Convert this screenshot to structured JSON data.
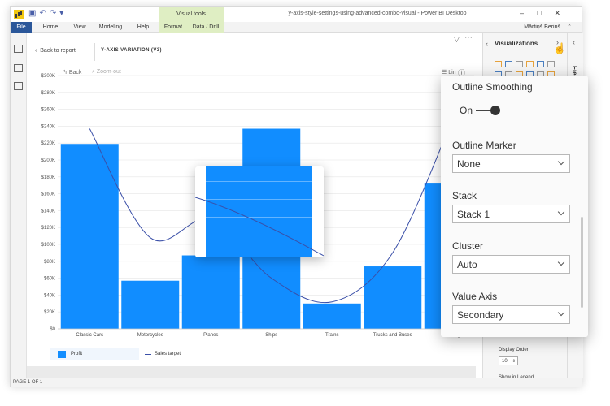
{
  "titlebar": {
    "visual_tools": "Visual tools",
    "window_title": "y-axis-style-settings-using-advanced-combo-visual - Power BI Desktop"
  },
  "ribbon": {
    "tabs": [
      "File",
      "Home",
      "View",
      "Modeling",
      "Help",
      "Format",
      "Data / Drill"
    ],
    "user": "Mārtiņš Beriņš"
  },
  "report": {
    "back_to_report": "Back to report",
    "visual_title": "Y-AXIS VARIATION (V3)",
    "back": "Back",
    "zoom_out": "Zoom-out",
    "lin": "Lin"
  },
  "chart_data": {
    "type": "bar",
    "categories": [
      "Classic Cars",
      "Motorcycles",
      "Planes",
      "Ships",
      "Trains",
      "Trucks and Buses",
      "Vintage Cars"
    ],
    "category_labels": [
      "Classic Cars",
      "Motorcycles",
      "Planes",
      "Ships",
      "Trains",
      "Trucks and Buses",
      "Vintag"
    ],
    "series": [
      {
        "name": "Profit",
        "type": "bar",
        "color": "#118dff",
        "values": [
          219000,
          57000,
          87000,
          237000,
          30000,
          74000,
          173000
        ]
      },
      {
        "name": "Sales target",
        "type": "line",
        "color": "#3a4fa8",
        "values": [
          237000,
          108000,
          130000,
          60000,
          32000,
          90000,
          250000
        ]
      }
    ],
    "yticks": [
      "$0",
      "$20K",
      "$40K",
      "$60K",
      "$80K",
      "$100K",
      "$120K",
      "$140K",
      "$160K",
      "$180K",
      "$200K",
      "$220K",
      "$240K",
      "$260K",
      "$280K",
      "$300K"
    ],
    "ylim": [
      0,
      300000
    ],
    "grid": true,
    "legend": "bottom-left"
  },
  "legend": {
    "profit": "Profit",
    "sales_target": "Sales target"
  },
  "status": {
    "page": "PAGE 1 OF 1"
  },
  "viz_panel": {
    "title": "Visualizations",
    "display_order_label": "Display Order",
    "display_order_value": "10",
    "show_in_legend": "Show in Legend",
    "fields": "Fields"
  },
  "format_panel": {
    "outline_smoothing": "Outline Smoothing",
    "toggle": "On",
    "outline_marker": "Outline Marker",
    "outline_marker_value": "None",
    "stack": "Stack",
    "stack_value": "Stack 1",
    "cluster": "Cluster",
    "cluster_value": "Auto",
    "value_axis": "Value Axis",
    "value_axis_value": "Secondary"
  },
  "colors": {
    "accent": "#118dff",
    "line": "#3a4fa8",
    "file_tab": "#2b579a",
    "visual_tools": "#dfeec3"
  }
}
